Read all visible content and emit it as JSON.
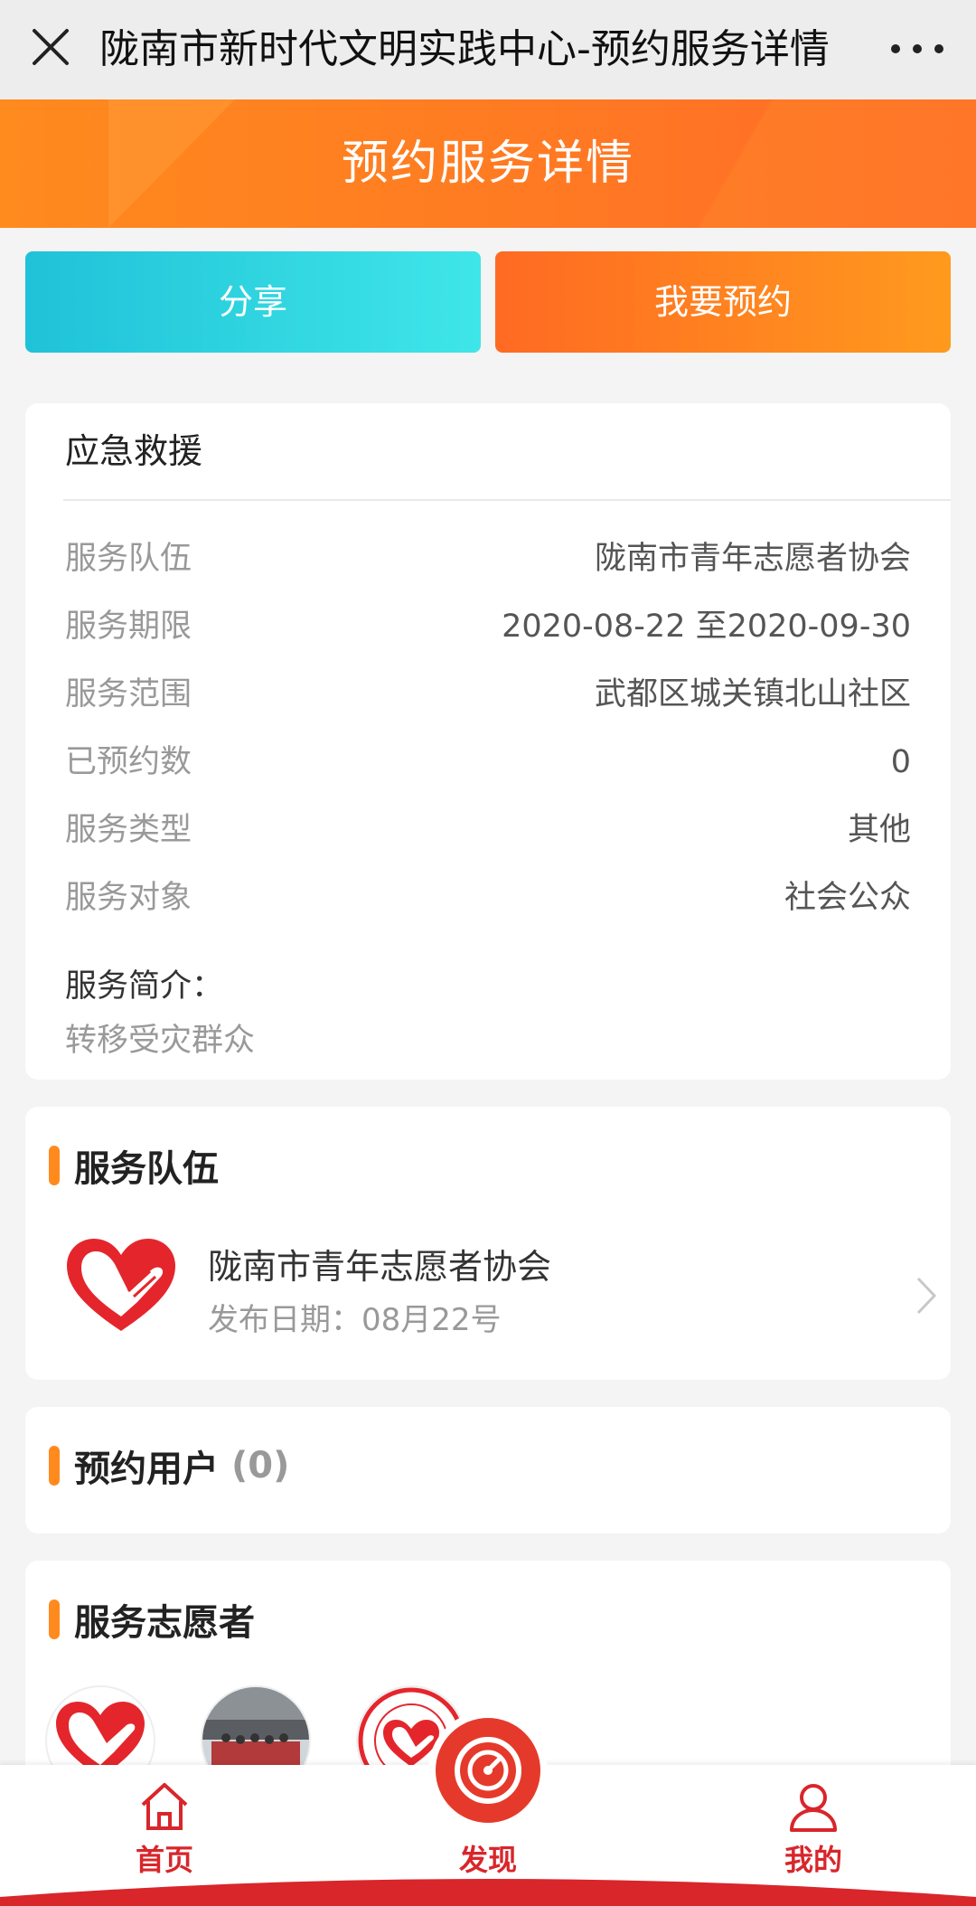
{
  "titlebar": {
    "title": "陇南市新时代文明实践中心-预约服务详情",
    "close_icon": "close-icon",
    "more_icon": "more-icon"
  },
  "banner": {
    "title": "预约服务详情"
  },
  "actions": {
    "share": "分享",
    "book": "我要预约"
  },
  "detail": {
    "heading": "应急救援",
    "rows": [
      {
        "key": "服务队伍",
        "value": "陇南市青年志愿者协会"
      },
      {
        "key": "服务期限",
        "value": "2020-08-22 至2020-09-30"
      },
      {
        "key": "服务范围",
        "value": "武都区城关镇北山社区"
      },
      {
        "key": "已预约数",
        "value": "0"
      },
      {
        "key": "服务类型",
        "value": "其他"
      },
      {
        "key": "服务对象",
        "value": "社会公众"
      }
    ],
    "intro_label": "服务简介：",
    "intro_text": "转移受灾群众"
  },
  "team": {
    "title": "服务队伍",
    "name": "陇南市青年志愿者协会",
    "date": "发布日期：08月22号"
  },
  "users": {
    "title": "预约用户",
    "count": "(0)"
  },
  "volunteers": {
    "title": "服务志愿者"
  },
  "tabbar": {
    "home": "首页",
    "find": "发现",
    "mine": "我的"
  },
  "colors": {
    "accent": "#ff8a1e",
    "share": "#1fc2d8",
    "brand_red": "#d8262b"
  }
}
